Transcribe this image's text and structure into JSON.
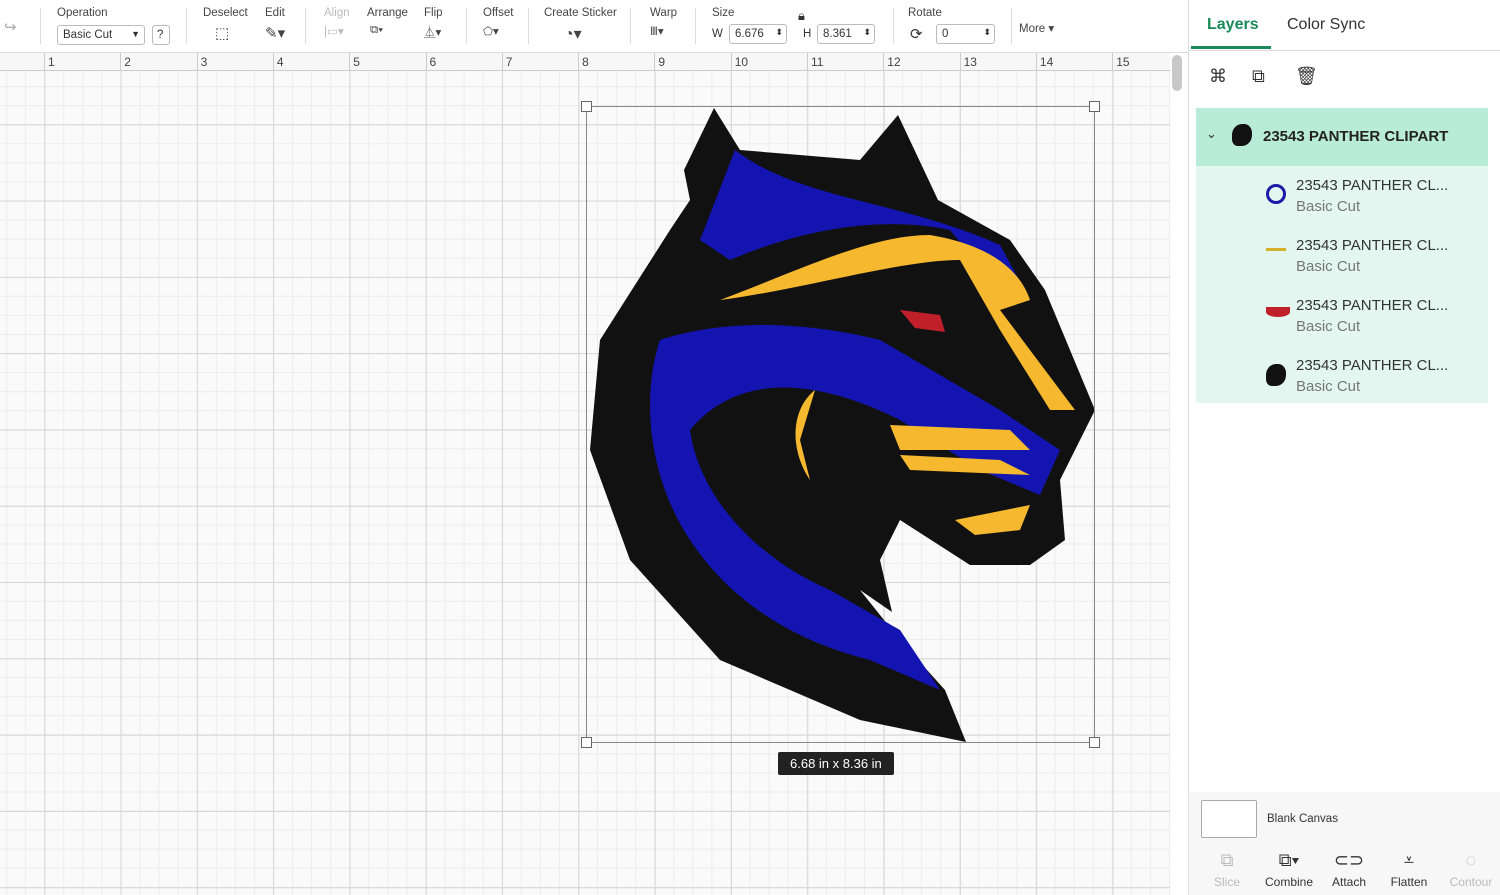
{
  "toolbar": {
    "operation_label": "Operation",
    "operation_value": "Basic Cut",
    "help": "?",
    "deselect": "Deselect",
    "edit": "Edit",
    "align": "Align",
    "arrange": "Arrange",
    "flip": "Flip",
    "offset": "Offset",
    "create_sticker": "Create Sticker",
    "warp": "Warp",
    "size": "Size",
    "w_label": "W",
    "w_value": "6.676",
    "h_label": "H",
    "h_value": "8.361",
    "rotate": "Rotate",
    "rotate_value": "0",
    "more": "More ▾"
  },
  "ruler": [
    "1",
    "2",
    "3",
    "4",
    "5",
    "6",
    "7",
    "8",
    "9",
    "10",
    "11",
    "12",
    "13",
    "14",
    "15"
  ],
  "canvas": {
    "dimension_label": "6.68  in x 8.36  in"
  },
  "panel": {
    "tabs": [
      "Layers",
      "Color Sync"
    ],
    "group": "23543 PANTHER CLIPART",
    "layers": [
      {
        "name": "23543 PANTHER CL...",
        "op": "Basic Cut",
        "color": "#1a1aa8"
      },
      {
        "name": "23543 PANTHER CL...",
        "op": "Basic Cut",
        "color": "#f5b82e"
      },
      {
        "name": "23543 PANTHER CL...",
        "op": "Basic Cut",
        "color": "#c0202a"
      },
      {
        "name": "23543 PANTHER CL...",
        "op": "Basic Cut",
        "color": "#111111"
      }
    ],
    "blank_canvas": "Blank Canvas",
    "bottom": [
      "Slice",
      "Combine",
      "Attach",
      "Flatten",
      "Contour"
    ]
  }
}
